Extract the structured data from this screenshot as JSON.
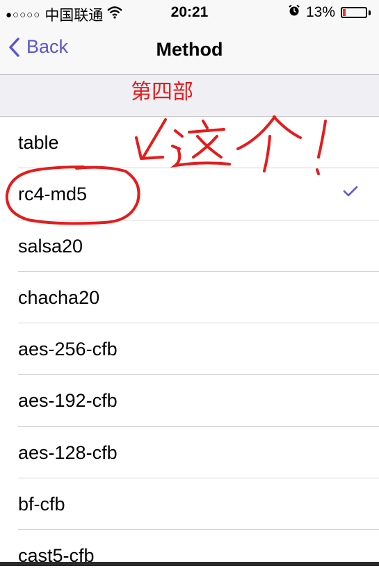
{
  "status_bar": {
    "signal_dots": "●○○○○",
    "carrier": "中国联通",
    "time": "20:21",
    "battery_percent": "13%",
    "battery_level": 0.13
  },
  "nav": {
    "back_label": "Back",
    "title": "Method"
  },
  "annotation": {
    "section_text": "第四部",
    "arrow_text": "这个!"
  },
  "methods": [
    {
      "label": "table",
      "selected": false
    },
    {
      "label": "rc4-md5",
      "selected": true
    },
    {
      "label": "salsa20",
      "selected": false
    },
    {
      "label": "chacha20",
      "selected": false
    },
    {
      "label": "aes-256-cfb",
      "selected": false
    },
    {
      "label": "aes-192-cfb",
      "selected": false
    },
    {
      "label": "aes-128-cfb",
      "selected": false
    },
    {
      "label": "bf-cfb",
      "selected": false
    },
    {
      "label": "cast5-cfb",
      "selected": false
    }
  ],
  "colors": {
    "accent": "#5856d6",
    "annotation": "#e51c1c"
  }
}
